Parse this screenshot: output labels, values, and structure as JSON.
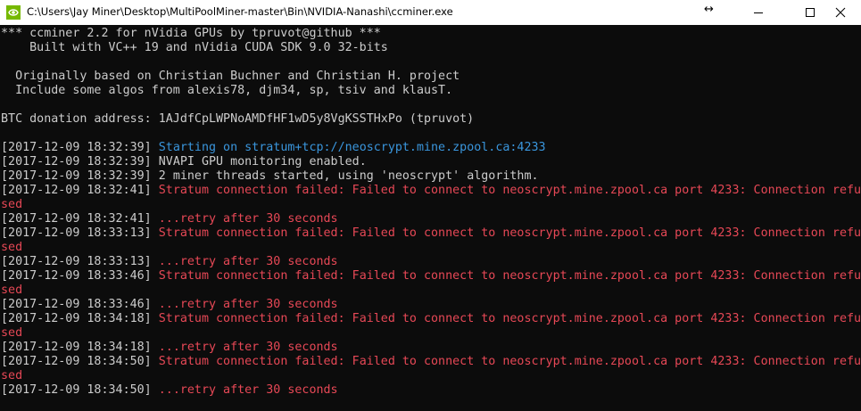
{
  "window": {
    "title": "C:\\Users\\Jay Miner\\Desktop\\MultiPoolMiner-master\\Bin\\NVIDIA-Nanashi\\ccminer.exe",
    "resize_glyph": "↔"
  },
  "console": {
    "header": [
      "*** ccminer 2.2 for nVidia GPUs by tpruvot@github ***",
      "    Built with VC++ 19 and nVidia CUDA SDK 9.0 32-bits",
      "",
      "  Originally based on Christian Buchner and Christian H. project",
      "  Include some algos from alexis78, djm34, sp, tsiv and klausT.",
      "",
      "BTC donation address: 1AJdfCpLWPNoAMDfHF1wD5y8VgKSSTHxPo (tpruvot)",
      ""
    ],
    "log": [
      {
        "ts": "[2017-12-09 18:32:39] ",
        "msg": "Starting on stratum+tcp://neoscrypt.mine.zpool.ca:4233",
        "color": "blue"
      },
      {
        "ts": "[2017-12-09 18:32:39] ",
        "msg": "NVAPI GPU monitoring enabled.",
        "color": "white"
      },
      {
        "ts": "[2017-12-09 18:32:39] ",
        "msg": "2 miner threads started, using 'neoscrypt' algorithm.",
        "color": "white"
      },
      {
        "ts": "[2017-12-09 18:32:41] ",
        "msg": "Stratum connection failed: Failed to connect to neoscrypt.mine.zpool.ca port 4233: Connection refu",
        "color": "red"
      },
      {
        "ts": "",
        "msg": "sed",
        "color": "red"
      },
      {
        "ts": "[2017-12-09 18:32:41] ",
        "msg": "...retry after 30 seconds",
        "color": "red"
      },
      {
        "ts": "[2017-12-09 18:33:13] ",
        "msg": "Stratum connection failed: Failed to connect to neoscrypt.mine.zpool.ca port 4233: Connection refu",
        "color": "red"
      },
      {
        "ts": "",
        "msg": "sed",
        "color": "red"
      },
      {
        "ts": "[2017-12-09 18:33:13] ",
        "msg": "...retry after 30 seconds",
        "color": "red"
      },
      {
        "ts": "[2017-12-09 18:33:46] ",
        "msg": "Stratum connection failed: Failed to connect to neoscrypt.mine.zpool.ca port 4233: Connection refu",
        "color": "red"
      },
      {
        "ts": "",
        "msg": "sed",
        "color": "red"
      },
      {
        "ts": "[2017-12-09 18:33:46] ",
        "msg": "...retry after 30 seconds",
        "color": "red"
      },
      {
        "ts": "[2017-12-09 18:34:18] ",
        "msg": "Stratum connection failed: Failed to connect to neoscrypt.mine.zpool.ca port 4233: Connection refu",
        "color": "red"
      },
      {
        "ts": "",
        "msg": "sed",
        "color": "red"
      },
      {
        "ts": "[2017-12-09 18:34:18] ",
        "msg": "...retry after 30 seconds",
        "color": "red"
      },
      {
        "ts": "[2017-12-09 18:34:50] ",
        "msg": "Stratum connection failed: Failed to connect to neoscrypt.mine.zpool.ca port 4233: Connection refu",
        "color": "red"
      },
      {
        "ts": "",
        "msg": "sed",
        "color": "red"
      },
      {
        "ts": "[2017-12-09 18:34:50] ",
        "msg": "...retry after 30 seconds",
        "color": "red"
      }
    ]
  },
  "colors": {
    "background": "#0c0c0c",
    "text": "#cccccc",
    "info": "#3a96dd",
    "error": "#e74856"
  }
}
